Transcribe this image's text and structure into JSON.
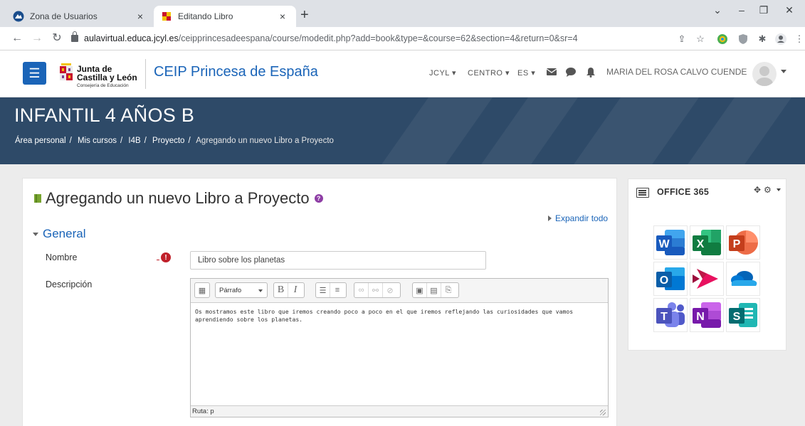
{
  "browser": {
    "tabs": [
      {
        "title": "Zona de Usuarios",
        "active": false
      },
      {
        "title": "Editando Libro",
        "active": true
      }
    ],
    "new_tab_symbol": "+",
    "close_symbol": "×",
    "window_controls": {
      "min": "–",
      "max": "❐",
      "close": "✕",
      "chevron": "⌄"
    },
    "address": {
      "host": "aulavirtual.educa.jcyl.es",
      "path": "/ceipprincesadeespana/course/modedit.php?add=book&type=&course=62&section=4&return=0&sr=4"
    }
  },
  "header": {
    "logo": {
      "line1": "Junta de",
      "line2": "Castilla y León",
      "line3": "Consejería de Educación"
    },
    "site_name": "CEIP Princesa de España",
    "menu": [
      {
        "label": "JCYL"
      },
      {
        "label": "CENTRO"
      },
      {
        "label": "ES"
      }
    ],
    "user_name": "MARIA DEL ROSA CALVO CUENDE"
  },
  "banner": {
    "course_title": "INFANTIL 4 AÑOS B",
    "breadcrumb": [
      {
        "label": "Área personal"
      },
      {
        "label": "Mis cursos"
      },
      {
        "label": "I4B"
      },
      {
        "label": "Proyecto"
      },
      {
        "label": "Agregando un nuevo Libro a Proyecto"
      }
    ],
    "separator": "/"
  },
  "form": {
    "heading": "Agregando un nuevo Libro a Proyecto",
    "expand_all": "Expandir todo",
    "section": "General",
    "name_label": "Nombre",
    "name_value": "Libro sobre los planetas",
    "description_label": "Descripción",
    "editor": {
      "format": "Párrafo",
      "content": "Os mostramos este libro que iremos creando poco a poco en el que iremos reflejando las curiosidades que vamos aprendiendo sobre los planetas.",
      "path": "Ruta: p"
    }
  },
  "office": {
    "title": "OFFICE 365",
    "apps": [
      {
        "name": "word",
        "letter": "W",
        "color": "#2b5797"
      },
      {
        "name": "excel",
        "letter": "X",
        "color": "#1e7145"
      },
      {
        "name": "powerpoint",
        "letter": "P",
        "color": "#d24726"
      },
      {
        "name": "outlook",
        "letter": "O",
        "color": "#0a64c8"
      },
      {
        "name": "stream",
        "letter": "",
        "color": "#bc1948"
      },
      {
        "name": "onedrive",
        "letter": "",
        "color": "#0a78d4"
      },
      {
        "name": "teams",
        "letter": "T",
        "color": "#5059c9"
      },
      {
        "name": "onenote",
        "letter": "N",
        "color": "#7719aa"
      },
      {
        "name": "sharepoint",
        "letter": "S",
        "color": "#038387"
      }
    ]
  }
}
